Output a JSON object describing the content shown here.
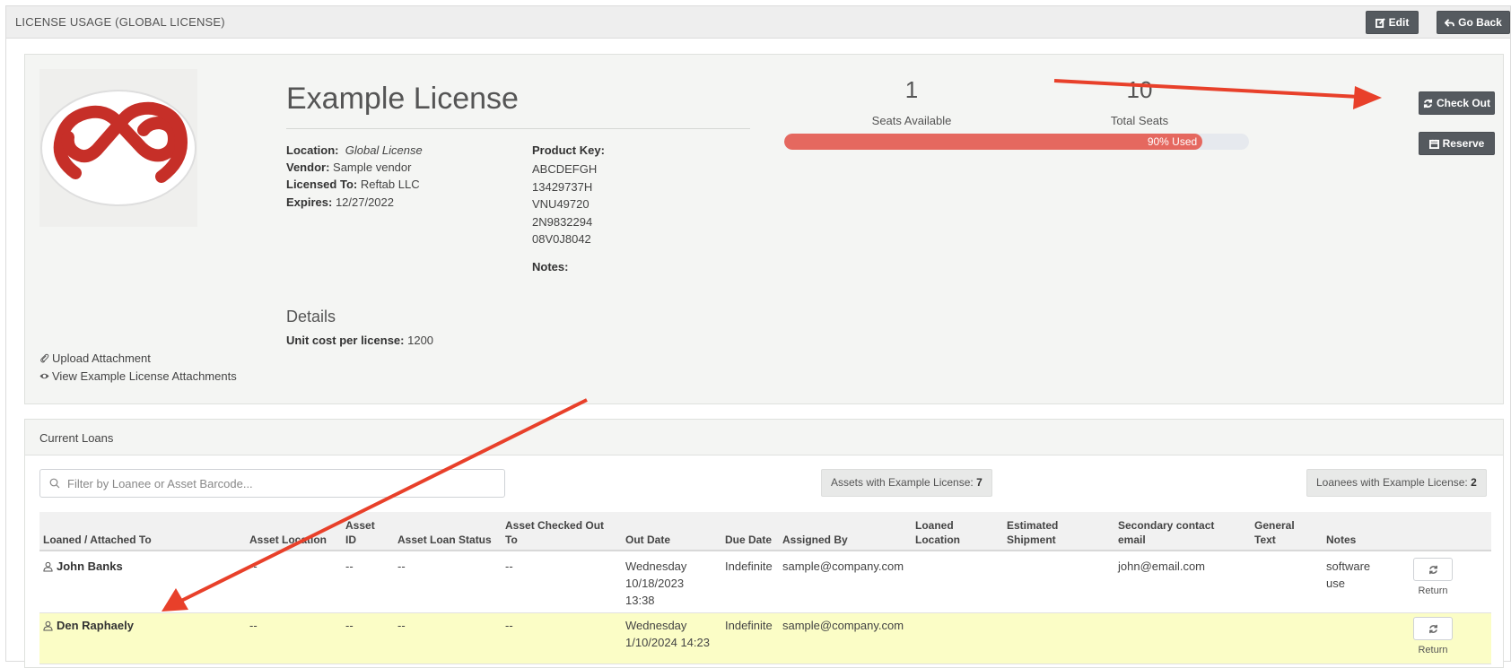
{
  "header": {
    "title": "LICENSE USAGE  (GLOBAL LICENSE)",
    "edit_label": "Edit",
    "go_back_label": "Go Back"
  },
  "license": {
    "name": "Example License",
    "location_label": "Location:",
    "location_value": "Global License",
    "vendor_label": "Vendor:",
    "vendor_value": "Sample vendor",
    "licensed_to_label": "Licensed To:",
    "licensed_to_value": "Reftab LLC",
    "expires_label": "Expires:",
    "expires_value": "12/27/2022",
    "product_key_label": "Product Key:",
    "product_keys": [
      "ABCDEFGH",
      "13429737H",
      "VNU49720",
      "2N9832294",
      "08V0J8042"
    ],
    "notes_label": "Notes:",
    "details_heading": "Details",
    "unit_cost_label": "Unit cost per license:",
    "unit_cost_value": "1200",
    "logo_icon": "creative-cloud-logo",
    "logo_color": "#c62f28"
  },
  "seats": {
    "available_value": "1",
    "available_label": "Seats Available",
    "total_value": "10",
    "total_label": "Total Seats",
    "used_fraction": 0.9,
    "used_label": "90% Used",
    "bar_color": "#e5685f"
  },
  "actions": {
    "check_out_label": "Check Out",
    "reserve_label": "Reserve",
    "upload_attachment_label": "Upload Attachment",
    "view_attachments_label": "View Example License Attachments"
  },
  "loans": {
    "heading": "Current Loans",
    "filter_placeholder": "Filter by Loanee or Asset Barcode...",
    "assets_pill_label": "Assets with Example License:",
    "assets_pill_count": "7",
    "loanees_pill_label": "Loanees with Example License:",
    "loanees_pill_count": "2",
    "columns": {
      "loaned_to": "Loaned / Attached To",
      "asset_location": "Asset Location",
      "asset_id": "Asset ID",
      "asset_loan_status": "Asset Loan Status",
      "asset_checked_out_to": "Asset Checked Out To",
      "out_date": "Out Date",
      "due_date": "Due Date",
      "assigned_by": "Assigned By",
      "loaned_location": "Loaned Location",
      "estimated_shipment": "Estimated Shipment",
      "secondary_contact_email": "Secondary contact email",
      "general_text": "General Text",
      "notes": "Notes"
    },
    "rows": [
      {
        "loanee": "John Banks",
        "asset_location": "--",
        "asset_id": "--",
        "asset_loan_status": "--",
        "asset_checked_out_to": "--",
        "out_date": "Wednesday 10/18/2023 13:38",
        "due_date": "Indefinite",
        "assigned_by": "sample@company.com",
        "loaned_location": "",
        "estimated_shipment": "",
        "secondary_contact_email": "john@email.com",
        "general_text": "",
        "notes": "software use",
        "return_label": "Return"
      },
      {
        "loanee": "Den Raphaely",
        "asset_location": "--",
        "asset_id": "--",
        "asset_loan_status": "--",
        "asset_checked_out_to": "--",
        "out_date": "Wednesday 1/10/2024 14:23",
        "due_date": "Indefinite",
        "assigned_by": "sample@company.com",
        "loaned_location": "",
        "estimated_shipment": "",
        "secondary_contact_email": "",
        "general_text": "",
        "notes": "",
        "return_label": "Return",
        "highlight_color": "#fbfdc6"
      }
    ]
  },
  "annotations": {
    "arrow_color": "#e8402a"
  }
}
